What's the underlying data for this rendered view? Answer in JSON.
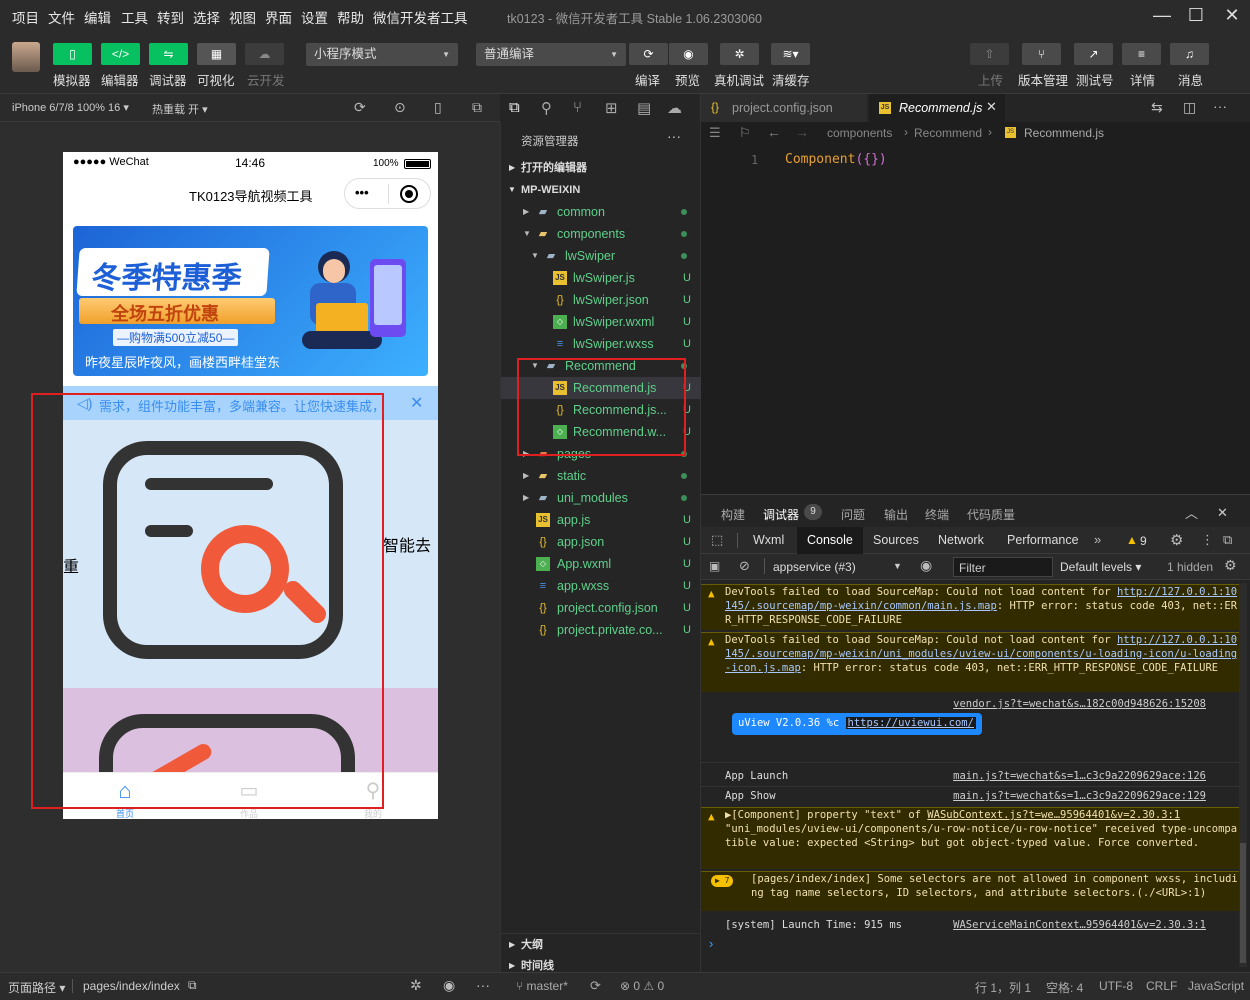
{
  "menubar": {
    "items": [
      "项目",
      "文件",
      "编辑",
      "工具",
      "转到",
      "选择",
      "视图",
      "界面",
      "设置",
      "帮助",
      "微信开发者工具"
    ],
    "title": "tk0123 - 微信开发者工具 Stable 1.06.2303060"
  },
  "toolbar": {
    "left_labels": [
      "模拟器",
      "编辑器",
      "调试器",
      "可视化",
      "云开发"
    ],
    "mode_select": "小程序模式",
    "compile_select": "普通编译",
    "mid_labels": [
      "编译",
      "预览",
      "真机调试",
      "清缓存"
    ],
    "right_labels": [
      "上传",
      "版本管理",
      "测试号",
      "详情",
      "消息"
    ]
  },
  "simulator": {
    "device": "iPhone 6/7/8 100% 16",
    "hot_reload": "热重载 开",
    "status_carrier": "●●●●● WeChat",
    "status_time": "14:46",
    "status_battery": "100%",
    "nav_title": "TK0123导航视频工具",
    "banner_title": "冬季特惠季",
    "banner_sub": "全场五折优惠",
    "banner_small": "—购物满500立减50—",
    "banner_caption": "昨夜星辰昨夜风，画楼西畔桂堂东",
    "notice_text": "需求，组件功能丰富，多端兼容。让您快速集成，",
    "card_text_a": "智能去",
    "card_text_b": "重",
    "tabs": [
      "首页",
      "作品",
      "我的"
    ]
  },
  "explorer": {
    "title": "资源管理器",
    "open_editors": "打开的编辑器",
    "root": "MP-WEIXIN",
    "items": [
      {
        "name": "common",
        "status": ""
      },
      {
        "name": "components",
        "status": ""
      },
      {
        "name": "lwSwiper",
        "status": ""
      },
      {
        "name": "lwSwiper.js",
        "status": "U"
      },
      {
        "name": "lwSwiper.json",
        "status": "U"
      },
      {
        "name": "lwSwiper.wxml",
        "status": "U"
      },
      {
        "name": "lwSwiper.wxss",
        "status": "U"
      },
      {
        "name": "Recommend",
        "status": ""
      },
      {
        "name": "Recommend.js",
        "status": "U"
      },
      {
        "name": "Recommend.js...",
        "status": "U"
      },
      {
        "name": "Recommend.w...",
        "status": "U"
      },
      {
        "name": "pages",
        "status": ""
      },
      {
        "name": "static",
        "status": ""
      },
      {
        "name": "uni_modules",
        "status": ""
      },
      {
        "name": "app.js",
        "status": "U"
      },
      {
        "name": "app.json",
        "status": "U"
      },
      {
        "name": "App.wxml",
        "status": "U"
      },
      {
        "name": "app.wxss",
        "status": "U"
      },
      {
        "name": "project.config.json",
        "status": "U"
      },
      {
        "name": "project.private.co...",
        "status": "U"
      }
    ],
    "outline": "大纲",
    "timeline": "时间线"
  },
  "editor": {
    "tab1": "project.config.json",
    "tab2": "Recommend.js",
    "crumb1": "components",
    "crumb2": "Recommend",
    "crumb3": "Recommend.js",
    "line_no": "1",
    "code_kw": "Component",
    "code_rest": "({})"
  },
  "panel": {
    "tabs": [
      "构建",
      "调试器",
      "问题",
      "输出",
      "终端",
      "代码质量"
    ],
    "debug_count": "9",
    "devtabs": [
      "Wxml",
      "Console",
      "Sources",
      "Network",
      "Performance"
    ],
    "warn_count": "9",
    "context": "appservice (#3)",
    "filter_placeholder": "Filter",
    "levels": "Default levels",
    "hidden": "1 hidden",
    "log1": "DevTools failed to load SourceMap: Could not load content for ",
    "log1_link": "http://127.0.0.1:10145/.sourcemap/mp-weixin/common/main.js.map",
    "log1_tail": ": HTTP error: status code 403, net::ERR_HTTP_RESPONSE_CODE_FAILURE",
    "log2": "DevTools failed to load SourceMap: Could not load content for ",
    "log2_link": "http://127.0.0.1:10145/.sourcemap/mp-weixin/uni_modules/uview-ui/components/u-loading-icon/u-loading-icon.js.map",
    "log2_tail": ": HTTP error: status code 403, net::ERR_HTTP_RESPONSE_CODE_FAILURE",
    "vendor_src": "vendor.js?t=wechat&s…182c00d948626:15208",
    "uview_badge": "uView V2.0.36",
    "uview_c": "%c",
    "uview_link": "https://uviewui.com/",
    "launch": "App Launch",
    "launch_src": "main.js?t=wechat&s=1…c3c9a2209629ace:126",
    "show": "App Show",
    "show_src": "main.js?t=wechat&s=1…c3c9a2209629ace:129",
    "warn3_head": "▶[Component] property \"text\" of ",
    "warn3_src": "WASubContext.js?t=we…95964401&v=2.30.3:1",
    "warn3_body": "\"uni_modules/uview-ui/components/u-row-notice/u-row-notice\" received type-uncompatible value: expected <String> but got object-typed value. Force converted.",
    "warn4_badge": "▶ 7",
    "warn4": "[pages/index/index] Some selectors are not allowed in component wxss, including tag name selectors, ID selectors, and attribute selectors.(./<URL>:1)",
    "sys": "[system] Launch Time: 915 ms",
    "sys_src": "WAServiceMainContext…95964401&v=2.30.3:1",
    "prompt": "›"
  },
  "statusbar": {
    "path_label": "页面路径",
    "path": "pages/index/index",
    "branch": "master*",
    "errors": "⊗ 0 ⚠ 0",
    "pos": "行 1，列 1",
    "spaces": "空格: 4",
    "encoding": "UTF-8",
    "eol": "CRLF",
    "lang": "JavaScript"
  },
  "colors": {
    "accent_green": "#07c160",
    "highlight_red": "#e02020",
    "tree_green": "#5fd08a"
  }
}
